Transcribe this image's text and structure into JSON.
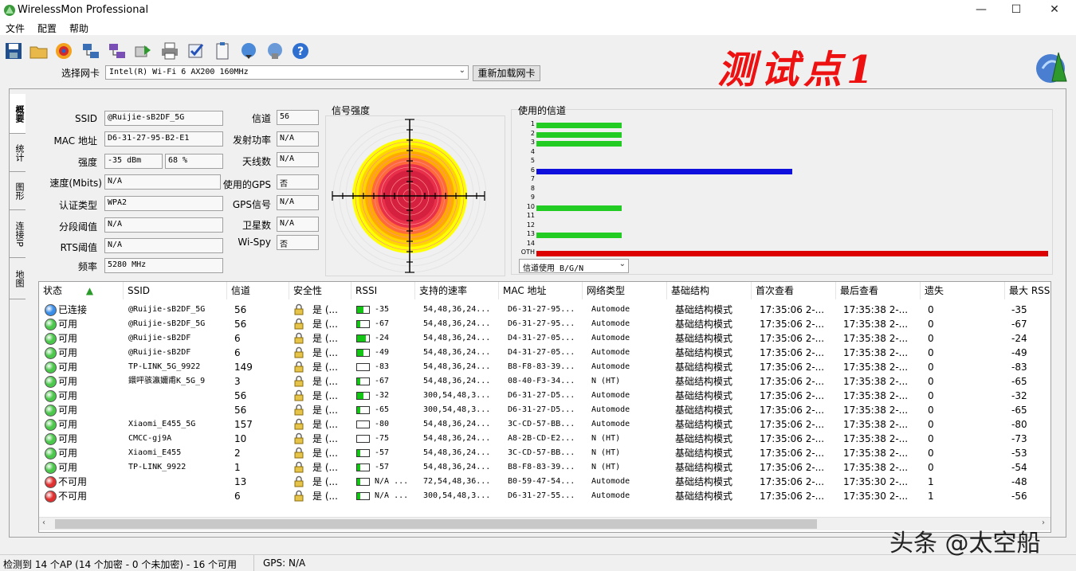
{
  "window": {
    "title": "WirelessMon Professional",
    "controls": {
      "minimize": "—",
      "maximize": "☐",
      "close": "✕"
    }
  },
  "menu": [
    "文件",
    "配置",
    "帮助"
  ],
  "toolbar": {
    "icons": [
      "save-icon",
      "folder-open-icon",
      "target-icon",
      "network-icon",
      "network-monitor-icon",
      "export-icon",
      "print-icon",
      "check-icon",
      "clipboard-icon",
      "globe-download-icon",
      "globe-info-icon",
      "help-icon"
    ]
  },
  "adapter": {
    "label": "选择网卡",
    "selected": "Intel(R) Wi-Fi 6 AX200 160MHz",
    "reload_label": "重新加载网卡"
  },
  "annotation": "测试点1",
  "side_tabs": [
    "概要",
    "统计",
    "图形",
    "连接IP",
    "地图"
  ],
  "summary": {
    "ssid_label": "SSID",
    "ssid": "@Ruijie-sB2DF_5G",
    "mac_label": "MAC 地址",
    "mac": "D6-31-27-95-B2-E1",
    "strength_label": "强度",
    "strength_dbm": "-35 dBm",
    "strength_pct": "68 %",
    "speed_label": "速度(Mbits)",
    "speed": "N/A",
    "auth_label": "认证类型",
    "auth": "WPA2",
    "frag_label": "分段阈值",
    "frag": "N/A",
    "rts_label": "RTS阈值",
    "rts": "N/A",
    "freq_label": "频率",
    "freq": "5280 MHz",
    "channel_label": "信道",
    "channel": "56",
    "txpower_label": "发射功率",
    "txpower": "N/A",
    "antenna_label": "天线数",
    "antenna": "N/A",
    "gps_used_label": "使用的GPS",
    "gps_used": "否",
    "gps_signal_label": "GPS信号",
    "gps_signal": "N/A",
    "satellites_label": "卫星数",
    "satellites": "N/A",
    "wispy_label": "Wi-Spy",
    "wispy": "否"
  },
  "signal_panel": {
    "title": "信号强度"
  },
  "channel_panel": {
    "title": "使用的信道",
    "selector": "信道使用 B/G/N"
  },
  "chart_data": {
    "type": "bar",
    "orientation": "horizontal",
    "categories": [
      "1",
      "2",
      "3",
      "4",
      "5",
      "6",
      "7",
      "8",
      "9",
      "10",
      "11",
      "12",
      "13",
      "14",
      "OTH"
    ],
    "values": [
      2,
      2,
      2,
      0,
      0,
      6,
      0,
      0,
      0,
      2,
      0,
      0,
      2,
      0,
      12
    ],
    "colors": [
      "#22cc22",
      "#22cc22",
      "#22cc22",
      "#22cc22",
      "#22cc22",
      "#1010dd",
      "#22cc22",
      "#22cc22",
      "#22cc22",
      "#22cc22",
      "#22cc22",
      "#22cc22",
      "#22cc22",
      "#22cc22",
      "#dd0000"
    ],
    "xlim": [
      0,
      12
    ]
  },
  "table": {
    "columns": [
      "状态",
      "SSID",
      "信道",
      "安全性",
      "RSSI",
      "支持的速率",
      "MAC 地址",
      "网络类型",
      "基础结构",
      "首次查看",
      "最后查看",
      "遗失",
      "最大 RSSI"
    ],
    "rows": [
      {
        "status": "已连接",
        "color": "#3a8ee8",
        "ssid": "@Ruijie-sB2DF_5G",
        "ch": "56",
        "sec": "是 (...",
        "sig": 0.5,
        "rssi": "-35",
        "rates": "54,48,36,24...",
        "mac": "D6-31-27-95...",
        "net": "Automode",
        "infra": "基础结构模式",
        "first": "17:35:06 2-...",
        "last": "17:35:38 2-...",
        "lost": "0",
        "max": "-35"
      },
      {
        "status": "可用",
        "color": "#4bc84b",
        "ssid": "@Ruijie-sB2DF_5G",
        "ch": "56",
        "sec": "是 (...",
        "sig": 0.25,
        "rssi": "-67",
        "rates": "54,48,36,24...",
        "mac": "D6-31-27-95...",
        "net": "Automode",
        "infra": "基础结构模式",
        "first": "17:35:06 2-...",
        "last": "17:35:38 2-...",
        "lost": "0",
        "max": "-67"
      },
      {
        "status": "可用",
        "color": "#4bc84b",
        "ssid": "@Ruijie-sB2DF",
        "ch": "6",
        "sec": "是 (...",
        "sig": 0.75,
        "rssi": "-24",
        "rates": "54,48,36,24...",
        "mac": "D4-31-27-05...",
        "net": "Automode",
        "infra": "基础结构模式",
        "first": "17:35:06 2-...",
        "last": "17:35:38 2-...",
        "lost": "0",
        "max": "-24"
      },
      {
        "status": "可用",
        "color": "#4bc84b",
        "ssid": "@Ruijie-sB2DF",
        "ch": "6",
        "sec": "是 (...",
        "sig": 0.5,
        "rssi": "-49",
        "rates": "54,48,36,24...",
        "mac": "D4-31-27-05...",
        "net": "Automode",
        "infra": "基础结构模式",
        "first": "17:35:06 2-...",
        "last": "17:35:38 2-...",
        "lost": "0",
        "max": "-49"
      },
      {
        "status": "可用",
        "color": "#4bc84b",
        "ssid": "TP-LINK_5G_9922",
        "ch": "149",
        "sec": "是 (...",
        "sig": 0,
        "rssi": "-83",
        "rates": "54,48,36,24...",
        "mac": "B8-F8-83-39...",
        "net": "Automode",
        "infra": "基础结构模式",
        "first": "17:35:06 2-...",
        "last": "17:35:38 2-...",
        "lost": "0",
        "max": "-83"
      },
      {
        "status": "可用",
        "color": "#4bc84b",
        "ssid": "鐶呯骇瀛嬭甫K_5G_9",
        "ch": "3",
        "sec": "是 (...",
        "sig": 0.25,
        "rssi": "-67",
        "rates": "54,48,36,24...",
        "mac": "08-40-F3-34...",
        "net": "N (HT)",
        "infra": "基础结构模式",
        "first": "17:35:06 2-...",
        "last": "17:35:38 2-...",
        "lost": "0",
        "max": "-65"
      },
      {
        "status": "可用",
        "color": "#4bc84b",
        "ssid": "",
        "ch": "56",
        "sec": "是 (...",
        "sig": 0.5,
        "rssi": "-32",
        "rates": "300,54,48,3...",
        "mac": "D6-31-27-D5...",
        "net": "Automode",
        "infra": "基础结构模式",
        "first": "17:35:06 2-...",
        "last": "17:35:38 2-...",
        "lost": "0",
        "max": "-32"
      },
      {
        "status": "可用",
        "color": "#4bc84b",
        "ssid": "",
        "ch": "56",
        "sec": "是 (...",
        "sig": 0.25,
        "rssi": "-65",
        "rates": "300,54,48,3...",
        "mac": "D6-31-27-D5...",
        "net": "Automode",
        "infra": "基础结构模式",
        "first": "17:35:06 2-...",
        "last": "17:35:38 2-...",
        "lost": "0",
        "max": "-65"
      },
      {
        "status": "可用",
        "color": "#4bc84b",
        "ssid": "Xiaomi_E455_5G",
        "ch": "157",
        "sec": "是 (...",
        "sig": 0,
        "rssi": "-80",
        "rates": "54,48,36,24...",
        "mac": "3C-CD-57-BB...",
        "net": "Automode",
        "infra": "基础结构模式",
        "first": "17:35:06 2-...",
        "last": "17:35:38 2-...",
        "lost": "0",
        "max": "-80"
      },
      {
        "status": "可用",
        "color": "#4bc84b",
        "ssid": "CMCC-gj9A",
        "ch": "10",
        "sec": "是 (...",
        "sig": 0,
        "rssi": "-75",
        "rates": "54,48,36,24...",
        "mac": "A8-2B-CD-E2...",
        "net": "N (HT)",
        "infra": "基础结构模式",
        "first": "17:35:06 2-...",
        "last": "17:35:38 2-...",
        "lost": "0",
        "max": "-73"
      },
      {
        "status": "可用",
        "color": "#4bc84b",
        "ssid": "Xiaomi_E455",
        "ch": "2",
        "sec": "是 (...",
        "sig": 0.25,
        "rssi": "-57",
        "rates": "54,48,36,24...",
        "mac": "3C-CD-57-BB...",
        "net": "N (HT)",
        "infra": "基础结构模式",
        "first": "17:35:06 2-...",
        "last": "17:35:38 2-...",
        "lost": "0",
        "max": "-53"
      },
      {
        "status": "可用",
        "color": "#4bc84b",
        "ssid": "TP-LINK_9922",
        "ch": "1",
        "sec": "是 (...",
        "sig": 0.25,
        "rssi": "-57",
        "rates": "54,48,36,24...",
        "mac": "B8-F8-83-39...",
        "net": "N (HT)",
        "infra": "基础结构模式",
        "first": "17:35:06 2-...",
        "last": "17:35:38 2-...",
        "lost": "0",
        "max": "-54"
      },
      {
        "status": "不可用",
        "color": "#e03030",
        "ssid": "",
        "ch": "13",
        "sec": "是 (...",
        "sig": 0.25,
        "rssi": "N/A ...",
        "rates": "72,54,48,36...",
        "mac": "B0-59-47-54...",
        "net": "Automode",
        "infra": "基础结构模式",
        "first": "17:35:06 2-...",
        "last": "17:35:30 2-...",
        "lost": "1",
        "max": "-48"
      },
      {
        "status": "不可用",
        "color": "#e03030",
        "ssid": "",
        "ch": "6",
        "sec": "是 (...",
        "sig": 0.25,
        "rssi": "N/A ...",
        "rates": "300,54,48,3...",
        "mac": "D6-31-27-55...",
        "net": "Automode",
        "infra": "基础结构模式",
        "first": "17:35:06 2-...",
        "last": "17:35:30 2-...",
        "lost": "1",
        "max": "-56"
      }
    ]
  },
  "status_bar": {
    "summary": "检测到 14 个AP (14 个加密 - 0 个未加密) - 16 个可用",
    "gps": "GPS: N/A"
  },
  "watermark": "头条 @太空船"
}
